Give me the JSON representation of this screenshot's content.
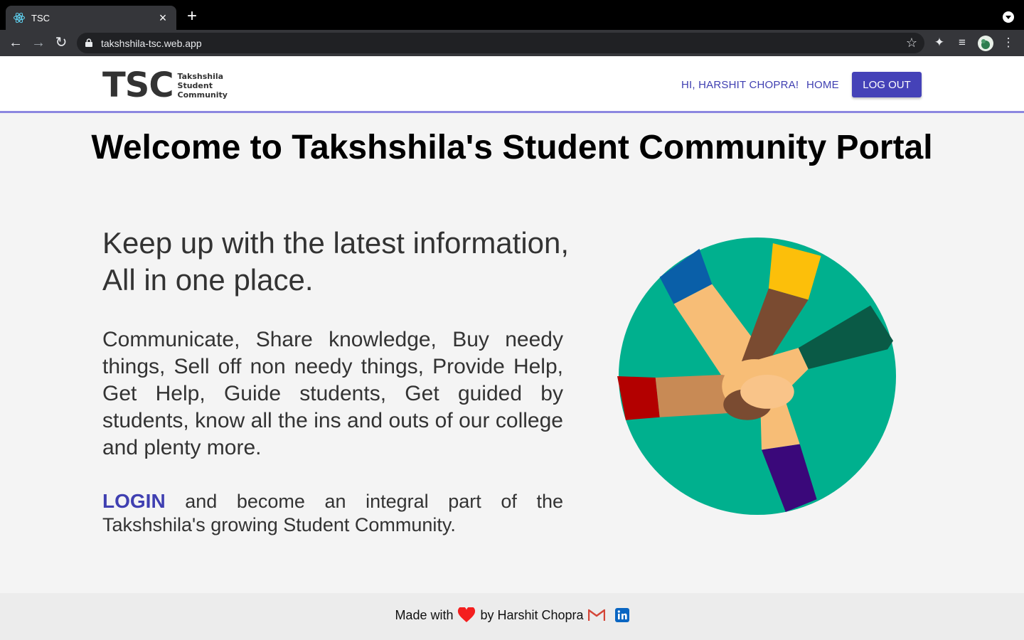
{
  "browser": {
    "tab_title": "TSC",
    "tab_close": "×",
    "new_tab": "+",
    "url": "takshshila-tsc.web.app"
  },
  "header": {
    "logo_main": "TSC",
    "logo_sub": [
      "Takshshila",
      "Student",
      "Community"
    ],
    "greeting": "HI, HARSHIT CHOPRA!",
    "home": "HOME",
    "logout": "LOG OUT"
  },
  "main": {
    "title": "Welcome to Takshshila's Student Community Portal",
    "tagline": "Keep up with the latest information, All in one place.",
    "description": "Communicate, Share knowledge, Buy needy things, Sell off non needy things, Provide Help, Get Help, Guide students, Get guided by students, know all the ins and outs of our college and plenty more.",
    "login_link": "LOGIN",
    "login_text": " and become an integral part of the Takshshila's growing Student Community."
  },
  "footer": {
    "made_with": "Made with",
    "by": "by Harshit Chopra"
  },
  "colors": {
    "accent": "#4542b8",
    "illustration_bg": "#00b08e"
  }
}
